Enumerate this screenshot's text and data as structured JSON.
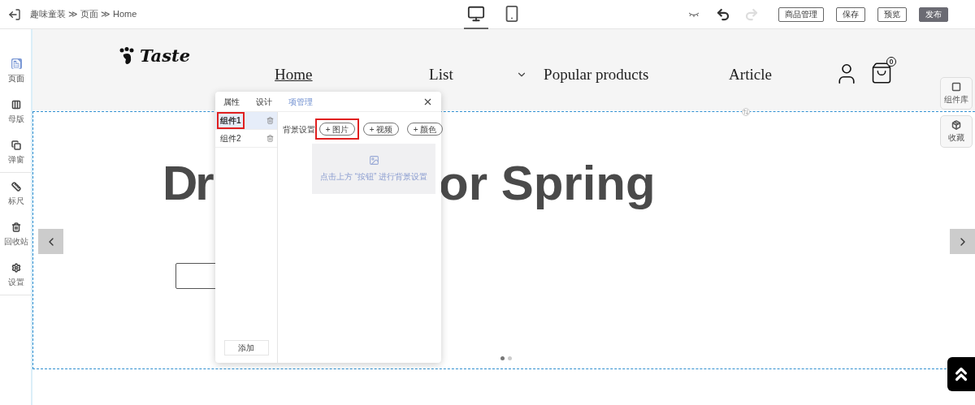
{
  "topbar": {
    "breadcrumb": [
      {
        "label": "趣味童装"
      },
      {
        "label": "页面"
      },
      {
        "label": "Home"
      }
    ],
    "separator": "≫",
    "devices": [
      {
        "kind": "desktop",
        "selected": true
      },
      {
        "kind": "mobile",
        "selected": false
      }
    ],
    "history": [
      {
        "kind": "undo",
        "disabled": false
      },
      {
        "kind": "redo",
        "disabled": true
      }
    ],
    "buttons": [
      {
        "label": "商品管理",
        "primary": false
      },
      {
        "label": "保存",
        "primary": false
      },
      {
        "label": "预览",
        "primary": false
      },
      {
        "label": "发布",
        "primary": true
      }
    ]
  },
  "sidebar": {
    "groups": [
      [
        {
          "label": "页面",
          "kind": "page",
          "selected": true
        },
        {
          "label": "母版",
          "kind": "master",
          "selected": false
        },
        {
          "label": "弹窗",
          "kind": "popup",
          "selected": false
        }
      ],
      [
        {
          "label": "标尺",
          "kind": "ruler",
          "selected": false
        },
        {
          "label": "回收站",
          "kind": "trash",
          "selected": false
        },
        {
          "label": "设置",
          "kind": "settings",
          "selected": false
        }
      ]
    ]
  },
  "site": {
    "logo": "Taste",
    "nav": [
      {
        "label": "Home",
        "selected": true,
        "dropdown": false
      },
      {
        "label": "List",
        "selected": false,
        "dropdown": true
      },
      {
        "label": "Popular products",
        "selected": false,
        "dropdown": false
      },
      {
        "label": "Article",
        "selected": false,
        "dropdown": false
      }
    ],
    "cart_count": "0"
  },
  "banner": {
    "heading_parts": [
      "Dr",
      "or Spring"
    ],
    "dots": [
      {
        "selected": true
      },
      {
        "selected": false
      }
    ]
  },
  "right_tools": [
    {
      "label": "组件库",
      "kind": "library"
    },
    {
      "label": "收藏",
      "kind": "favorites"
    }
  ],
  "dialog": {
    "tabs": [
      {
        "label": "属性",
        "selected": false
      },
      {
        "label": "设计",
        "selected": false
      },
      {
        "label": "项管理",
        "selected": true
      }
    ],
    "items": [
      {
        "label": "组件1",
        "selected": true,
        "highlighted": true
      },
      {
        "label": "组件2",
        "selected": false,
        "highlighted": false
      }
    ],
    "add_button": "添加",
    "background_label": "背景设置",
    "background_buttons": [
      {
        "label": "+ 图片",
        "highlighted": true
      },
      {
        "label": "+ 视频",
        "highlighted": false
      },
      {
        "label": "+ 颜色",
        "highlighted": false
      }
    ],
    "hint": "点击上方 “按钮” 进行背景设置"
  }
}
